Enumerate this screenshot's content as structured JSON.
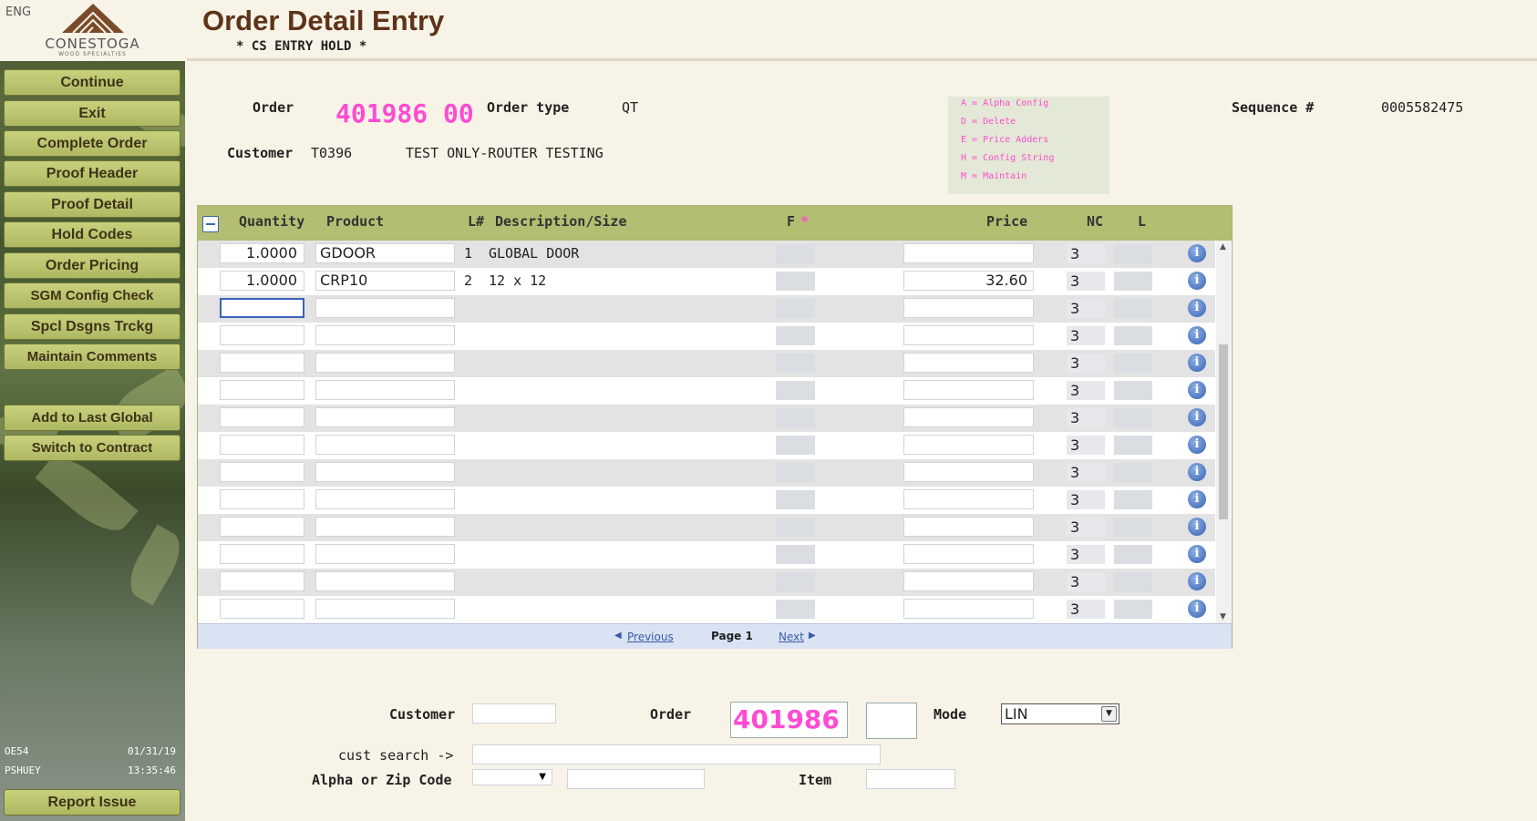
{
  "app": {
    "lang": "ENG",
    "logo_text": "CONESTOGA",
    "logo_sub": "WOOD SPECIALTIES",
    "title": "Order Detail Entry",
    "subtitle": "* CS ENTRY HOLD *"
  },
  "sidebar": {
    "buttons": [
      "Continue",
      "Exit",
      "Complete Order",
      "Proof Header",
      "Proof Detail",
      "Hold Codes",
      "Order Pricing",
      "SGM Config Check",
      "Spcl Dsgns Trckg",
      "Maintain Comments"
    ],
    "buttons2": [
      "Add to Last Global",
      "Switch to Contract"
    ],
    "report_issue": "Report Issue",
    "status": {
      "program": "OE54",
      "date": "01/31/19",
      "user": "PSHUEY",
      "time": "13:35:46"
    }
  },
  "order_header": {
    "order_label": "Order",
    "order_value": "401986 00",
    "order_type_label": "Order type",
    "order_type_value": "QT",
    "customer_label": "Customer",
    "customer_code": "T0396",
    "customer_name": "TEST ONLY-ROUTER TESTING",
    "sequence_label": "Sequence #",
    "sequence_value": "0005582475"
  },
  "legend": [
    "A = Alpha Config",
    "D = Delete",
    "E = Price Adders",
    "H = Config String",
    "M = Maintain"
  ],
  "grid": {
    "headers": {
      "quantity": "Quantity",
      "product": "Product",
      "line": "L#",
      "description": "Description/Size",
      "f": "F",
      "f_marker": "*",
      "price": "Price",
      "nc": "NC",
      "l": "L"
    },
    "rows": [
      {
        "qty": "1.0000",
        "product": "GDOOR",
        "line": "1",
        "desc": "GLOBAL DOOR",
        "price": "",
        "nc": "3"
      },
      {
        "qty": "1.0000",
        "product": "CRP10",
        "line": "2",
        "desc": "12 x 12",
        "price": "32.60",
        "nc": "3"
      },
      {
        "qty": "",
        "product": "",
        "line": "",
        "desc": "",
        "price": "",
        "nc": "3"
      },
      {
        "qty": "",
        "product": "",
        "line": "",
        "desc": "",
        "price": "",
        "nc": "3"
      },
      {
        "qty": "",
        "product": "",
        "line": "",
        "desc": "",
        "price": "",
        "nc": "3"
      },
      {
        "qty": "",
        "product": "",
        "line": "",
        "desc": "",
        "price": "",
        "nc": "3"
      },
      {
        "qty": "",
        "product": "",
        "line": "",
        "desc": "",
        "price": "",
        "nc": "3"
      },
      {
        "qty": "",
        "product": "",
        "line": "",
        "desc": "",
        "price": "",
        "nc": "3"
      },
      {
        "qty": "",
        "product": "",
        "line": "",
        "desc": "",
        "price": "",
        "nc": "3"
      },
      {
        "qty": "",
        "product": "",
        "line": "",
        "desc": "",
        "price": "",
        "nc": "3"
      },
      {
        "qty": "",
        "product": "",
        "line": "",
        "desc": "",
        "price": "",
        "nc": "3"
      },
      {
        "qty": "",
        "product": "",
        "line": "",
        "desc": "",
        "price": "",
        "nc": "3"
      },
      {
        "qty": "",
        "product": "",
        "line": "",
        "desc": "",
        "price": "",
        "nc": "3"
      },
      {
        "qty": "",
        "product": "",
        "line": "",
        "desc": "",
        "price": "",
        "nc": "3"
      }
    ],
    "pager": {
      "previous": "Previous",
      "page": "Page 1",
      "next": "Next"
    }
  },
  "bottom_form": {
    "customer_label": "Customer",
    "customer_value": "",
    "order_label": "Order",
    "order_value": "401986",
    "order_suffix": "",
    "mode_label": "Mode",
    "mode_value": "LIN",
    "cust_search_label": "cust search ->",
    "cust_search_value": "",
    "alpha_label": "Alpha or Zip Code",
    "alpha_select_value": "",
    "alpha_value": "",
    "item_label": "Item",
    "item_value": ""
  },
  "colors": {
    "accent_magenta": "#ff4bd2",
    "title_brown": "#5e3319",
    "grid_header": "#b3be72",
    "button_green": "#bcc46e"
  }
}
